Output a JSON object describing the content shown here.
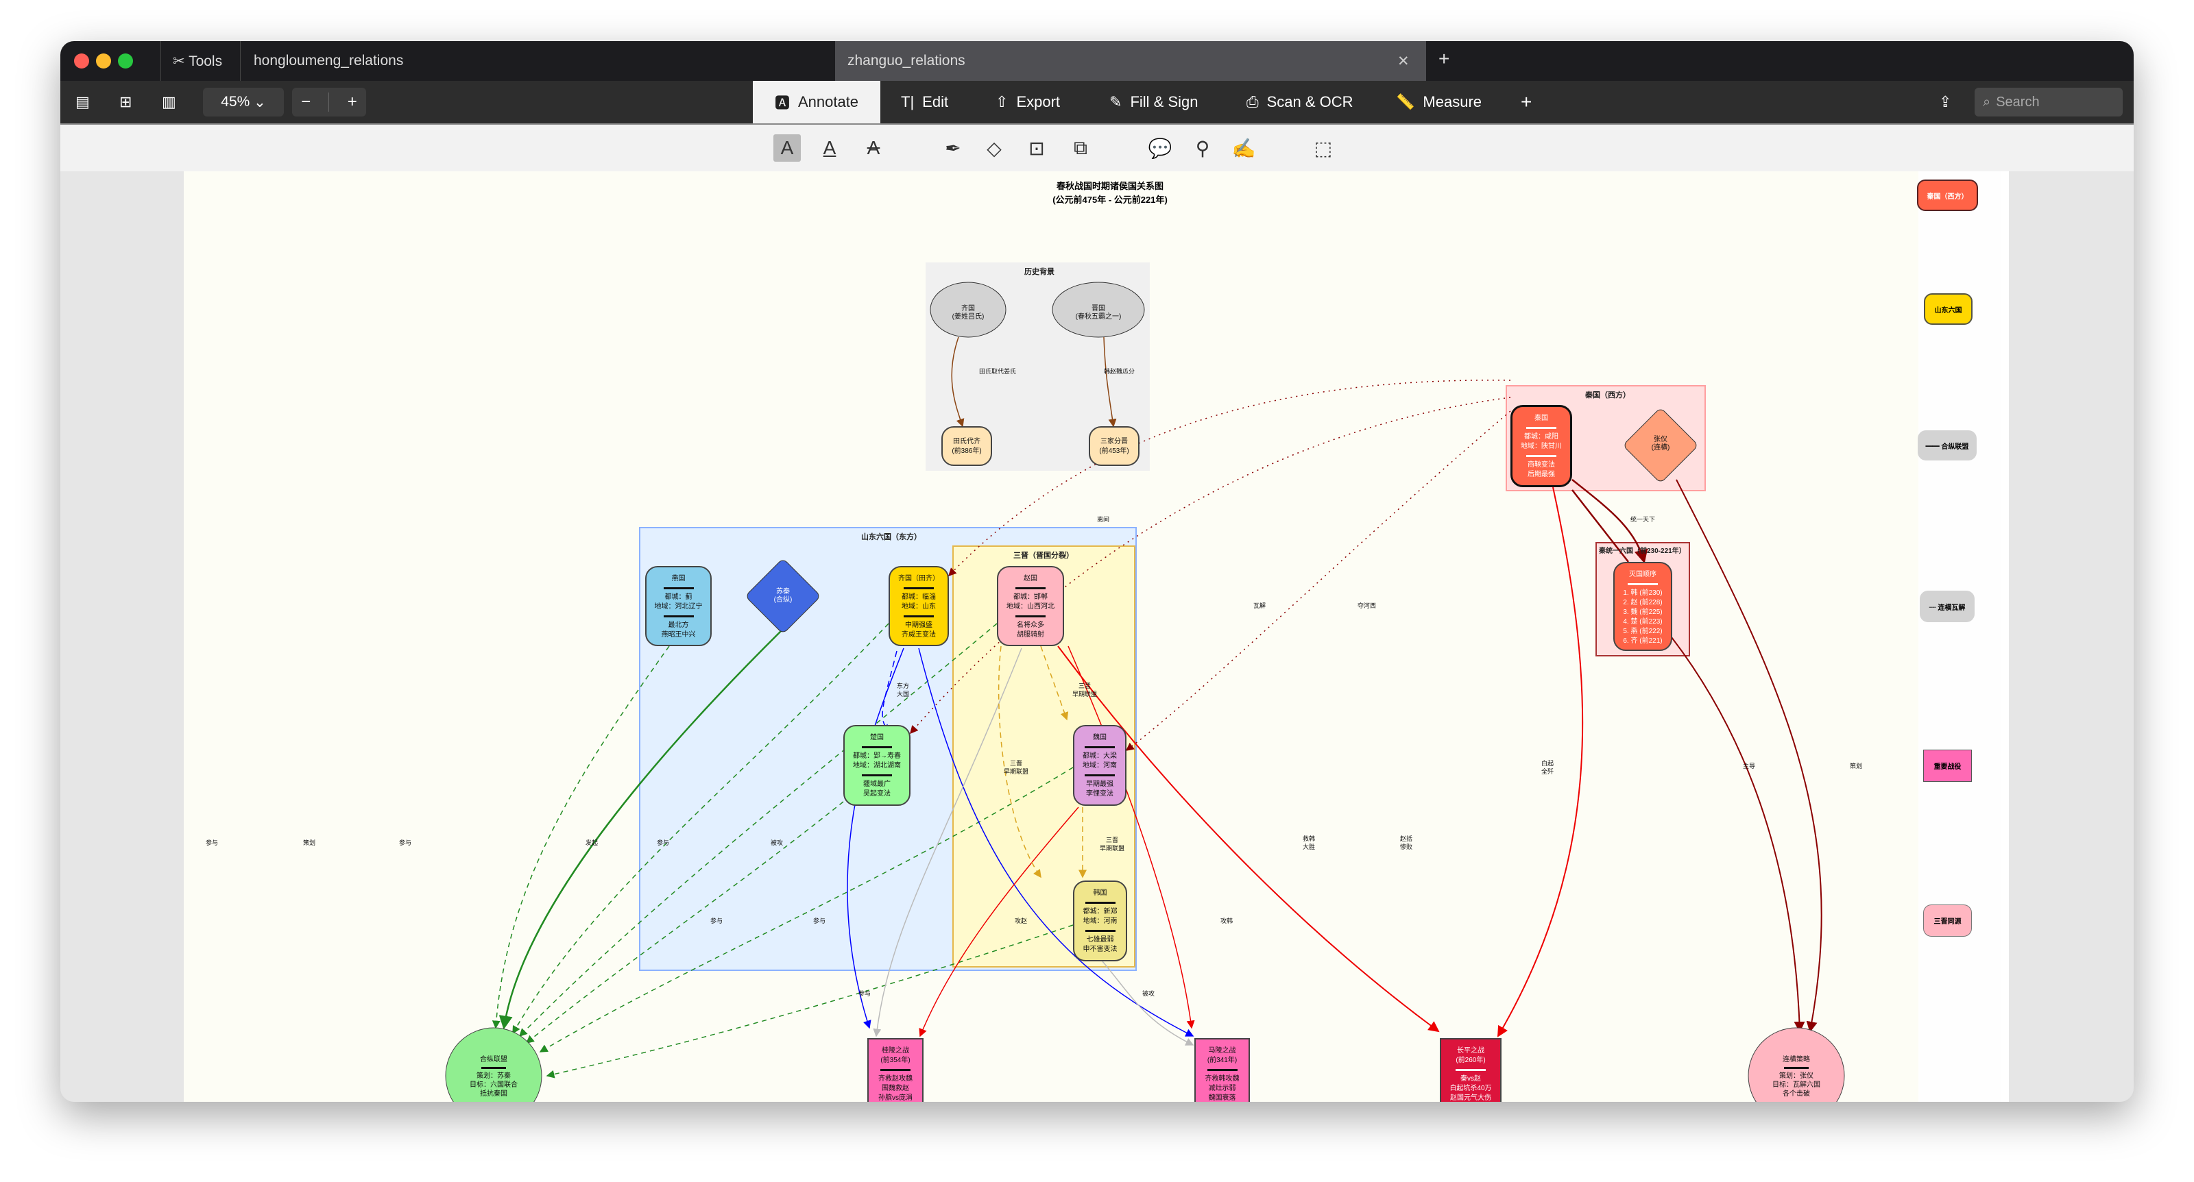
{
  "window": {
    "tools_label": "Tools",
    "tabs": [
      {
        "label": "hongloumeng_relations"
      },
      {
        "label": "zhanguo_relations"
      }
    ]
  },
  "toolbar": {
    "zoom": "45%",
    "zoom_out": "−",
    "zoom_in": "+",
    "modes": [
      "Annotate",
      "Edit",
      "Export",
      "Fill & Sign",
      "Scan & OCR",
      "Measure"
    ],
    "add": "+",
    "search_placeholder": "Search"
  },
  "diagram": {
    "title": "春秋战国时期诸侯国关系图",
    "subtitle": "(公元前475年 - 公元前221年)",
    "clusters": {
      "history": "历史背景",
      "qin": "秦国（西方）",
      "unify": "秦统一六国（前230-221年）",
      "east": "山东六国（东方）",
      "sanjin": "三晋（晋国分裂）"
    },
    "history": {
      "qi_old": [
        "齐国",
        "(姜姓吕氏)"
      ],
      "jin_old": [
        "晋国",
        "(春秋五霸之一)"
      ],
      "tian": [
        "田氏代齐",
        "(前386年)"
      ],
      "sanjia": [
        "三家分晋",
        "(前453年)"
      ]
    },
    "nodes": {
      "qin": {
        "name": "秦国",
        "l1": "都城：咸阳",
        "l2": "地域：陕甘川",
        "n1": "商鞅变法",
        "n2": "后期最强"
      },
      "zhangyi": [
        "张仪",
        "(连横)"
      ],
      "order": {
        "title": "灭国顺序",
        "items": [
          "1. 韩 (前230)",
          "2. 赵 (前228)",
          "3. 魏 (前225)",
          "4. 楚 (前223)",
          "5. 燕 (前222)",
          "6. 齐 (前221)"
        ]
      },
      "yan": {
        "name": "燕国",
        "l1": "都城：蓟",
        "l2": "地域：河北辽宁",
        "n1": "最北方",
        "n2": "燕昭王中兴"
      },
      "suqin": [
        "苏秦",
        "(合纵)"
      ],
      "qi": {
        "name": "齐国（田齐）",
        "l1": "都城：临淄",
        "l2": "地域：山东",
        "n1": "中期强盛",
        "n2": "齐威王变法"
      },
      "zhao": {
        "name": "赵国",
        "l1": "都城：邯郸",
        "l2": "地域：山西河北",
        "n1": "名将众多",
        "n2": "胡服骑射"
      },
      "chu": {
        "name": "楚国",
        "l1": "都城：郢→寿春",
        "l2": "地域：湖北湖南",
        "n1": "疆域最广",
        "n2": "吴起变法"
      },
      "wei": {
        "name": "魏国",
        "l1": "都城：大梁",
        "l2": "地域：河南",
        "n1": "早期最强",
        "n2": "李悝变法"
      },
      "han": {
        "name": "韩国",
        "l1": "都城：新郑",
        "l2": "地域：河南",
        "n1": "七雄最弱",
        "n2": "申不害变法"
      },
      "hezong": {
        "name": "合纵联盟",
        "l1": "策划：苏秦",
        "l2": "目标：六国联合",
        "l3": "抵抗秦国"
      },
      "guiling": {
        "name": "桂陵之战",
        "year": "(前354年)",
        "l1": "齐救赵攻魏",
        "l2": "围魏救赵",
        "l3": "孙膑vs庞涓"
      },
      "maling": {
        "name": "马陵之战",
        "year": "(前341年)",
        "l1": "齐救韩攻魏",
        "l2": "减灶示弱",
        "l3": "魏国衰落"
      },
      "changping": {
        "name": "长平之战",
        "year": "(前260年)",
        "l1": "秦vs赵",
        "l2": "白起坑杀40万",
        "l3": "赵国元气大伤"
      },
      "lianheng": {
        "name": "连横策略",
        "l1": "策划：张仪",
        "l2": "目标：瓦解六国",
        "l3": "各个击破"
      }
    },
    "edge_labels": {
      "tian": "田氏取代姜氏",
      "sanjia": "韩赵魏瓜分",
      "unify": "统一天下",
      "lijian": "离间",
      "wajie": "瓦解",
      "hexi": "夺河西",
      "dongfang": [
        "东方",
        "大国"
      ],
      "sj1": [
        "三晋",
        "早期联盟"
      ],
      "sj2": [
        "三晋",
        "早期联盟"
      ],
      "sj3": [
        "三晋",
        "早期联盟"
      ],
      "p1": "参与",
      "p2": "策划",
      "p3": "参与",
      "p4": "发起",
      "p5": "参与",
      "p6": "被攻",
      "p7": "参与",
      "p8": "参与",
      "p9": "攻赵",
      "p10": "攻韩",
      "p11": "参与",
      "p12": "被攻",
      "jiuhan": [
        "救韩",
        "大胜"
      ],
      "zhaokuo": [
        "赵括",
        "惨败"
      ],
      "baiqi": [
        "白起",
        "全歼"
      ],
      "zhudao": "主导",
      "cehua": "策划"
    },
    "legend": [
      "秦国（西方）",
      "山东六国",
      "━━ 合纵联盟",
      "┈ 连横瓦解",
      "重要战役",
      "三晋同源"
    ]
  },
  "colors": {
    "qin": "#ff6347",
    "qi": "#ffd700",
    "yan": "#87ceeb",
    "zhao": "#ffb6c1",
    "chu": "#98fb98",
    "wei": "#dda0dd",
    "han": "#f0e68c",
    "battle": "#ff69b4",
    "changping": "#dc143c"
  }
}
